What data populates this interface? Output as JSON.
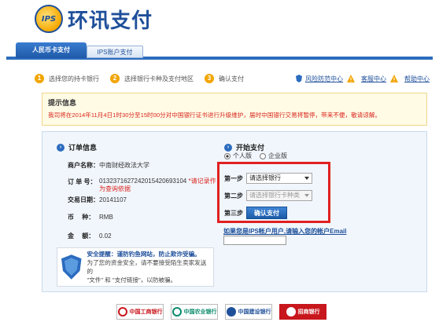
{
  "brand": {
    "logo_badge": "IPS",
    "logo_text": "环讯支付",
    "color": "#1e4f9a"
  },
  "tabs": [
    {
      "label": "人民币卡支付",
      "active": true
    },
    {
      "label": "IPS账户支付",
      "active": false
    }
  ],
  "steps": [
    {
      "num": "1",
      "label": "选择您的持卡银行"
    },
    {
      "num": "2",
      "label": "选择银行卡种及支付地区"
    },
    {
      "num": "3",
      "label": "确认支付"
    }
  ],
  "links": {
    "risk": "风险防范中心",
    "service": "客服中心",
    "help": "帮助中心"
  },
  "notice": {
    "title": "提示信息",
    "body": "我司将在2014年11月4日1时30分至15时00分对中国银行证书进行升级维护，届时中国银行交易将暂停，带来不便，敬请谅解。"
  },
  "order": {
    "title": "订单信息",
    "merchant_label": "商户名称：",
    "merchant": "中南财经政法大学",
    "order_no_label": "订 单 号：",
    "order_no": "01323716272420154206931​04",
    "order_note": "*请记录作为查询依据",
    "date_label": "交易日期：",
    "date": "20141107",
    "currency_label": "币　 种：",
    "currency": "RMB",
    "amount_label": "金　 额：",
    "amount": "0.02"
  },
  "security": {
    "title": "安全提醒：",
    "slogan": "谨防钓鱼网站，防止欺诈受骗。",
    "line1": "为了您的资金安全，请不要接受陌生卖家发送的",
    "line2": "\"文件\" 和 \"支付链接\"，以防被骗。"
  },
  "payment": {
    "title": "开始支付",
    "personal": "个人版",
    "enterprise": "企业版",
    "step1_label": "第一步",
    "step1_value": "请选择银行",
    "step2_label": "第二步",
    "step2_value": "请选择银行卡种类",
    "step3_label": "第三步",
    "confirm_label": "确认支付",
    "ips_prompt": "如果您是IPS帐户用户,请输入您的帐户Email",
    "email_value": ""
  },
  "banks": [
    {
      "name": "中国工商银行",
      "color": "#c8161d"
    },
    {
      "name": "中国农业银行",
      "color": "#0a8a6b"
    },
    {
      "name": "中国建设银行",
      "color": "#1e4f9a"
    },
    {
      "name": "招商银行",
      "color": "#c8161d"
    }
  ]
}
